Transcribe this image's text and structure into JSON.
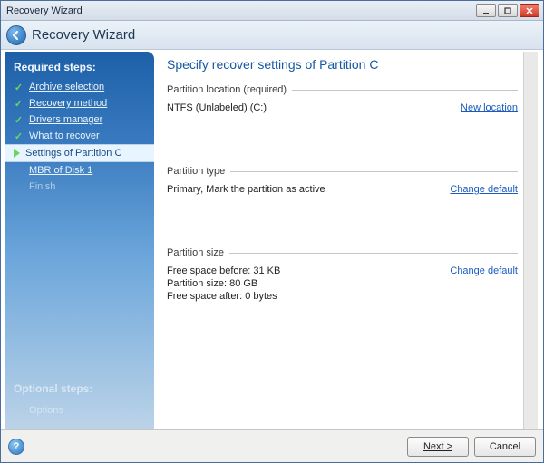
{
  "window": {
    "title": "Recovery Wizard",
    "header_title": "Recovery Wizard"
  },
  "sidebar": {
    "required_header": "Required steps:",
    "optional_header": "Optional steps:",
    "items": [
      {
        "label": "Archive selection",
        "state": "done"
      },
      {
        "label": "Recovery method",
        "state": "done"
      },
      {
        "label": "Drivers manager",
        "state": "done"
      },
      {
        "label": "What to recover",
        "state": "done"
      },
      {
        "label": "Settings of Partition C",
        "state": "active"
      },
      {
        "label": "MBR of Disk 1",
        "state": "pending"
      },
      {
        "label": "Finish",
        "state": "disabled"
      }
    ],
    "optional_item": "Options"
  },
  "main": {
    "title": "Specify recover settings of Partition C",
    "sections": {
      "location": {
        "heading": "Partition location (required)",
        "value": "NTFS (Unlabeled) (C:)",
        "link": "New location"
      },
      "type": {
        "heading": "Partition type",
        "value": "Primary, Mark the partition as active",
        "link": "Change default"
      },
      "size": {
        "heading": "Partition size",
        "lines": [
          "Free space before: 31 KB",
          "Partition size: 80 GB",
          "Free space after: 0 bytes"
        ],
        "link": "Change default"
      }
    }
  },
  "footer": {
    "next": "Next >",
    "cancel": "Cancel"
  }
}
